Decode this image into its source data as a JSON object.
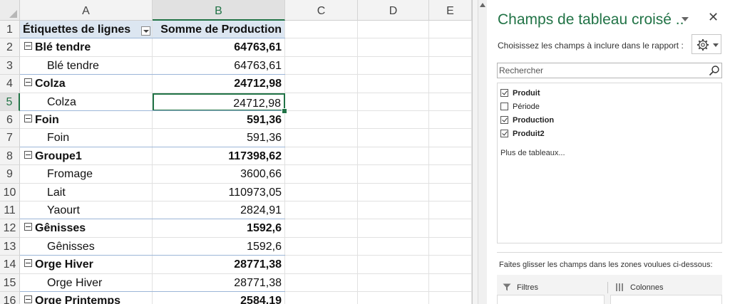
{
  "columns": [
    "A",
    "B",
    "C",
    "D",
    "E"
  ],
  "rows": [
    {
      "n": "1",
      "a": "Étiquettes de lignes",
      "b": "Somme de Production",
      "kind": "header"
    },
    {
      "n": "2",
      "a": "Blé tendre",
      "b": "64763,61",
      "kind": "group"
    },
    {
      "n": "3",
      "a": "Blé tendre",
      "b": "64763,61",
      "kind": "child"
    },
    {
      "n": "4",
      "a": "Colza",
      "b": "24712,98",
      "kind": "group"
    },
    {
      "n": "5",
      "a": "Colza",
      "b": "24712,98",
      "kind": "child"
    },
    {
      "n": "6",
      "a": "Foin",
      "b": "591,36",
      "kind": "group"
    },
    {
      "n": "7",
      "a": "Foin",
      "b": "591,36",
      "kind": "child"
    },
    {
      "n": "8",
      "a": "Groupe1",
      "b": "117398,62",
      "kind": "group"
    },
    {
      "n": "9",
      "a": "Fromage",
      "b": "3600,66",
      "kind": "child"
    },
    {
      "n": "10",
      "a": "Lait",
      "b": "110973,05",
      "kind": "child"
    },
    {
      "n": "11",
      "a": "Yaourt",
      "b": "2824,91",
      "kind": "child"
    },
    {
      "n": "12",
      "a": "Gênisses",
      "b": "1592,6",
      "kind": "group"
    },
    {
      "n": "13",
      "a": "Gênisses",
      "b": "1592,6",
      "kind": "child"
    },
    {
      "n": "14",
      "a": "Orge Hiver",
      "b": "28771,38",
      "kind": "group"
    },
    {
      "n": "15",
      "a": "Orge Hiver",
      "b": "28771,38",
      "kind": "child"
    },
    {
      "n": "16",
      "a": "Orge Printemps",
      "b": "2584,19",
      "kind": "group"
    }
  ],
  "selected_cell": {
    "column": "B",
    "row": "5"
  },
  "pane": {
    "title": "Champs de tableau croisé ..",
    "close": "✕",
    "subtitle": "Choisissez les champs à inclure dans le rapport :",
    "search_placeholder": "Rechercher",
    "fields": [
      {
        "label": "Produit",
        "checked": true
      },
      {
        "label": "Période",
        "checked": false
      },
      {
        "label": "Production",
        "checked": true
      },
      {
        "label": "Produit2",
        "checked": true
      }
    ],
    "more_tables": "Plus de tableaux...",
    "drag_hint": "Faites glisser les champs dans les zones voulues ci-dessous:",
    "area_filters": "Filtres",
    "area_columns": "Colonnes"
  },
  "colors": {
    "accent": "#217346",
    "header_fill": "#dce6f1"
  }
}
